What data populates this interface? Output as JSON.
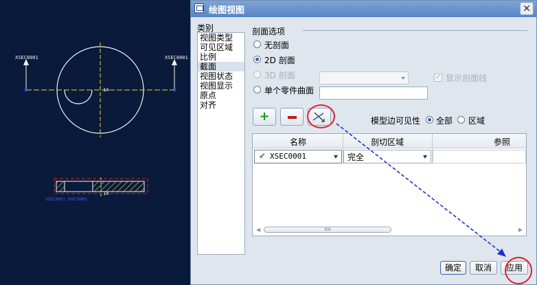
{
  "cad": {
    "left_label": "XSEC0001",
    "right_label": "XSEC0001",
    "dim1": "14",
    "dim2": "14",
    "bottom_label": "XSEC0001 XSEC0001"
  },
  "dialog": {
    "title": "绘图视图",
    "close": "✕",
    "category": {
      "label": "类别",
      "items": [
        "视图类型",
        "可见区域",
        "比例",
        "截面",
        "视图状态",
        "视图显示",
        "原点",
        "对齐"
      ],
      "selected_index": 3
    },
    "section_options": {
      "title": "剖面选项",
      "options": [
        {
          "label": "无剖面",
          "selected": false,
          "enabled": true
        },
        {
          "label": "2D 剖面",
          "selected": true,
          "enabled": true
        },
        {
          "label": "3D 剖面",
          "selected": false,
          "enabled": false
        },
        {
          "label": "单个零件曲面",
          "selected": false,
          "enabled": true
        }
      ],
      "show_section_lines": "显示剖面线"
    },
    "toolbar": {
      "add": "+",
      "model_edge_visibility": "模型边可见性",
      "all": "全部",
      "area": "区域",
      "visibility_selected": "全部"
    },
    "table": {
      "columns": [
        "名称",
        "剖切区域",
        "参照"
      ],
      "rows": [
        {
          "name": "XSEC0001",
          "area": "完全",
          "ref": ""
        }
      ],
      "scroll_grip": "ıııı"
    },
    "buttons": {
      "ok": "确定",
      "cancel": "取消",
      "apply": "应用"
    },
    "colors": {
      "annotation": "#e0202a",
      "arrow": "#1c2fd0",
      "cad_background": "#0a1a3a"
    }
  }
}
